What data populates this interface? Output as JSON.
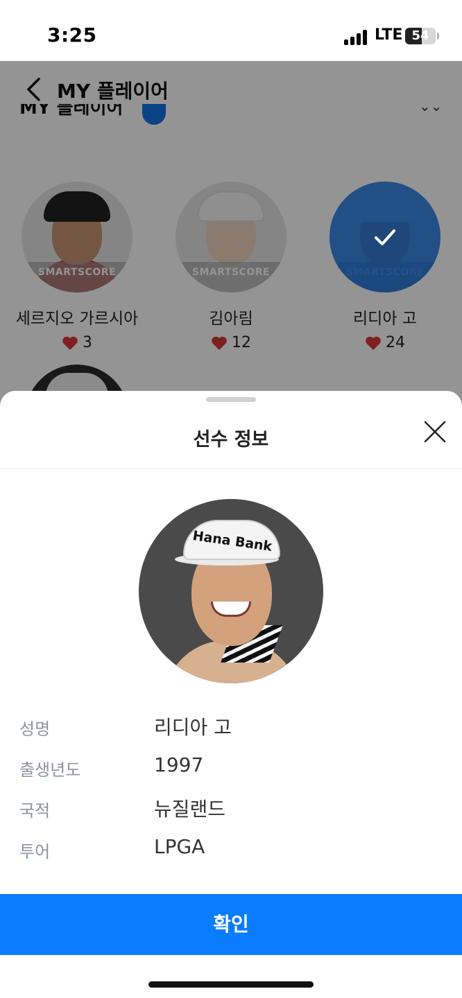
{
  "status_bar": {
    "time": "3:25",
    "network": "LTE",
    "battery": "54",
    "battery_fraction": 0.54
  },
  "header": {
    "title": "MY 플레이어"
  },
  "section": {
    "title": "MY 플레이어"
  },
  "players": [
    {
      "name": "세르지오 가르시아",
      "likes": "3",
      "watermark": "SMARTSCORE",
      "selected": false
    },
    {
      "name": "김아림",
      "likes": "12",
      "watermark": "SMARTSCORE",
      "selected": false
    },
    {
      "name": "리디아 고",
      "likes": "24",
      "watermark": "SMARTSCORE",
      "selected": true
    }
  ],
  "sheet": {
    "title": "선수 정보",
    "photo_brand": "Hana Bank",
    "rows": [
      {
        "label": "성명",
        "value": "리디아 고"
      },
      {
        "label": "출생년도",
        "value": "1997"
      },
      {
        "label": "국적",
        "value": "뉴질랜드"
      },
      {
        "label": "투어",
        "value": "LPGA"
      }
    ],
    "confirm_label": "확인"
  },
  "colors": {
    "accent": "#0A7CFF",
    "selected_overlay": "#1473E6",
    "heart": "#D93838",
    "label": "#8D93A0"
  },
  "icons": {
    "back": "chevron-left-icon",
    "close": "close-icon",
    "check": "check-icon",
    "heart": "heart-icon"
  }
}
